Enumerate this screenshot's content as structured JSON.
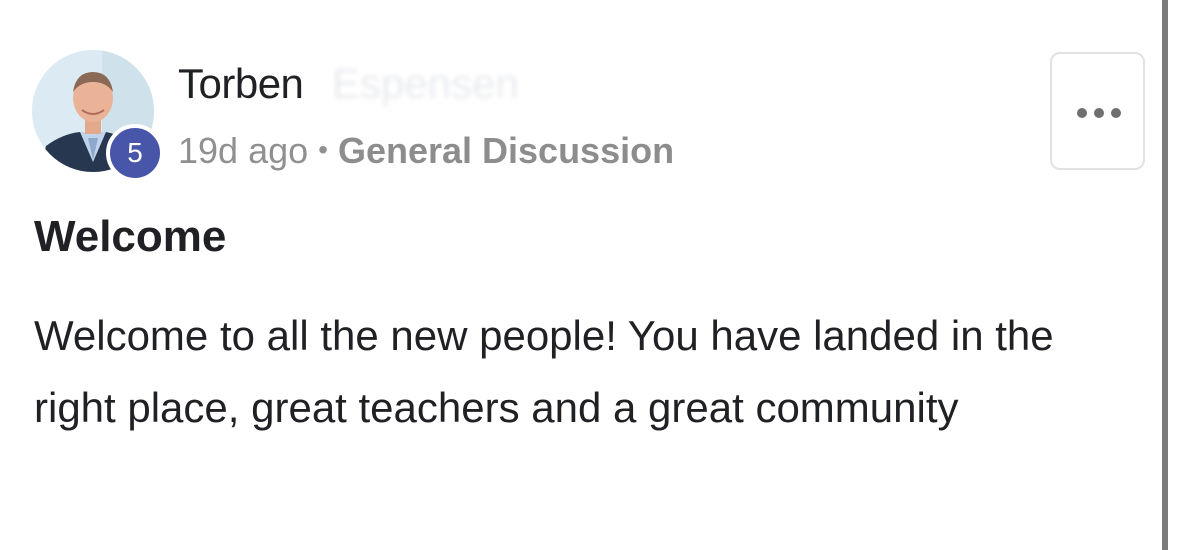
{
  "post": {
    "author": {
      "first_name": "Torben",
      "surname_blurred": "Espensen",
      "level": "5",
      "avatar_icon": "profile-photo"
    },
    "meta": {
      "time_ago": "19d ago",
      "separator": "•",
      "category": "General Discussion"
    },
    "more_icon": "ellipsis-icon",
    "title": "Welcome",
    "body": "Welcome to all the new people! You have landed in the right place, great teachers and a great community"
  },
  "colors": {
    "level_badge": "#4756a8",
    "meta_text": "#909090",
    "text": "#202124"
  }
}
